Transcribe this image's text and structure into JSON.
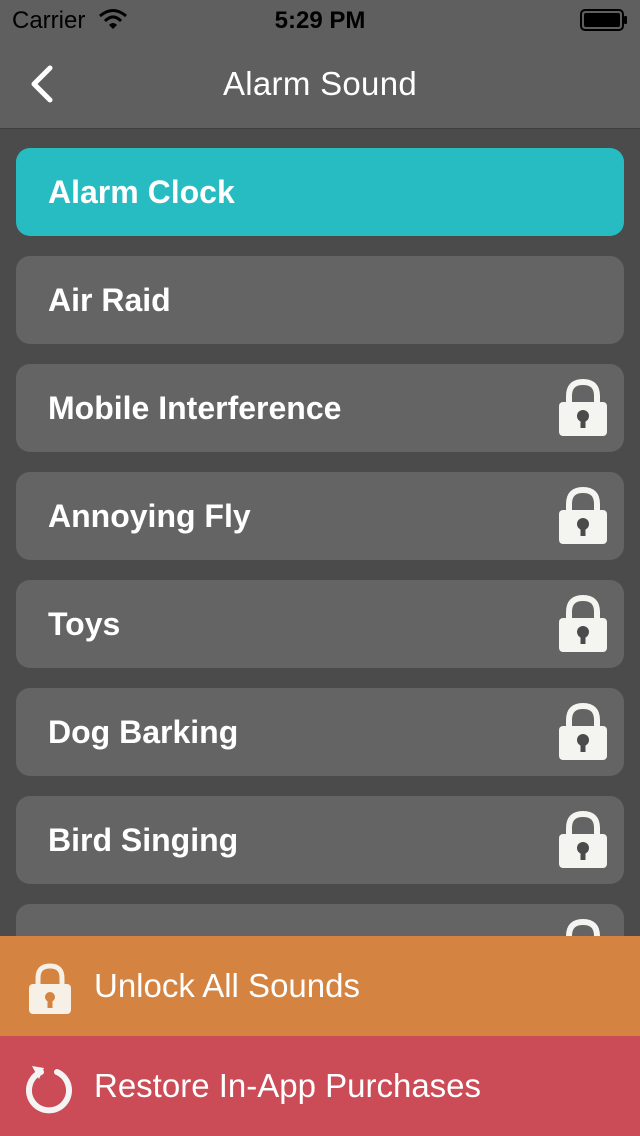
{
  "status_bar": {
    "carrier": "Carrier",
    "time": "5:29 PM"
  },
  "nav": {
    "title": "Alarm Sound",
    "back_icon": "chevron-left-icon"
  },
  "sounds": [
    {
      "label": "Alarm Clock",
      "selected": true,
      "locked": false
    },
    {
      "label": "Air Raid",
      "selected": false,
      "locked": false
    },
    {
      "label": "Mobile Interference",
      "selected": false,
      "locked": true
    },
    {
      "label": "Annoying Fly",
      "selected": false,
      "locked": true
    },
    {
      "label": "Toys",
      "selected": false,
      "locked": true
    },
    {
      "label": "Dog Barking",
      "selected": false,
      "locked": true
    },
    {
      "label": "Bird Singing",
      "selected": false,
      "locked": true
    },
    {
      "label": "",
      "selected": false,
      "locked": true
    }
  ],
  "actions": {
    "unlock_label": "Unlock All Sounds",
    "restore_label": "Restore In-App Purchases"
  },
  "colors": {
    "background": "#4b4b4b",
    "bar": "#5f5f5f",
    "item": "#646464",
    "selected": "#27bcc2",
    "unlock": "#d48340",
    "restore": "#cb4c57"
  }
}
